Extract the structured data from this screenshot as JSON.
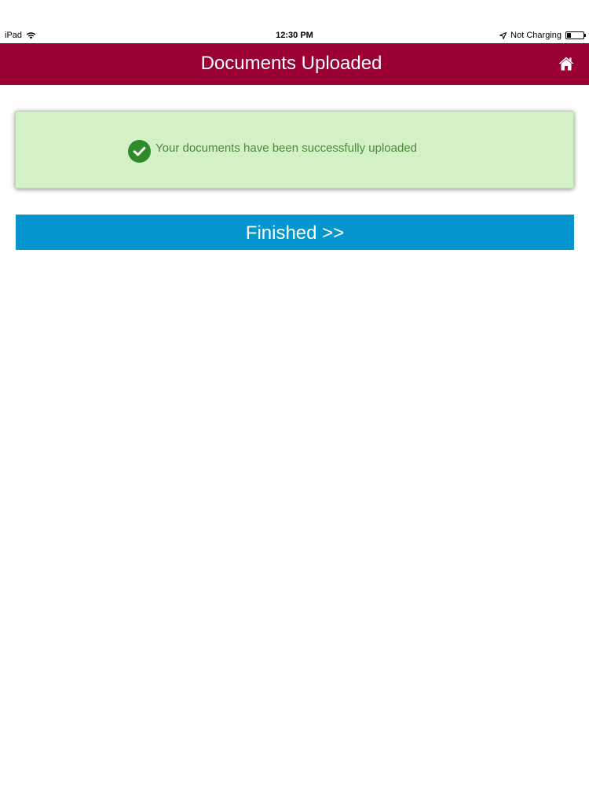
{
  "status_bar": {
    "device": "iPad",
    "time": "12:30 PM",
    "battery_status": "Not Charging",
    "battery_level": 0.25,
    "icons": [
      "wifi-icon",
      "location-icon",
      "battery-icon"
    ]
  },
  "header": {
    "title": "Documents Uploaded",
    "home_icon": "home-icon"
  },
  "alert": {
    "icon": "check-circle-icon",
    "message": "Your documents have been successfully uploaded"
  },
  "actions": {
    "finished_label": "Finished >>"
  },
  "colors": {
    "header_bg": "#9b0034",
    "alert_bg": "#d3f0c6",
    "alert_text": "#4a8c3c",
    "check_icon": "#2f8a2a",
    "button_bg": "#0696cf"
  }
}
